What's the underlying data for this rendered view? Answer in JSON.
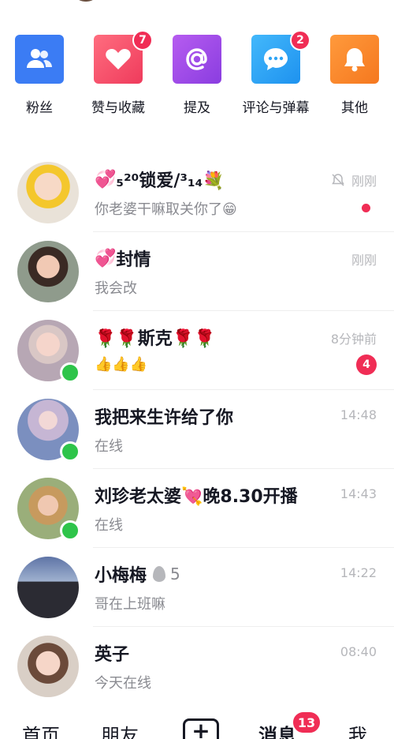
{
  "actions": [
    {
      "label": "粉丝",
      "icon": "fans-icon",
      "color": "#3b7cf4"
    },
    {
      "label": "赞与收藏",
      "icon": "heart-icon",
      "color": "#f24b6a",
      "badge": "7"
    },
    {
      "label": "提及",
      "icon": "at-icon",
      "color": "#9b4ee6"
    },
    {
      "label": "评论与弹幕",
      "icon": "comment-icon",
      "color": "#2ea4f5",
      "badge": "2"
    },
    {
      "label": "其他",
      "icon": "bell-icon",
      "color": "#f7892b"
    }
  ],
  "chats": [
    {
      "name_prefix": "💞",
      "name": "₅²⁰锁爱/³₁₄💐",
      "preview": "你老婆干嘛取关你了😁",
      "time": "刚刚",
      "muted": true,
      "dot": true
    },
    {
      "name_prefix": "💞",
      "name": "封情",
      "preview": "我会改",
      "time": "刚刚"
    },
    {
      "name": "🌹🌹斯克🌹🌹",
      "preview": "👍👍👍",
      "time": "8分钟前",
      "unread": "4",
      "online": true
    },
    {
      "name": "我把来生许给了你",
      "preview": "在线",
      "time": "14:48",
      "online": true
    },
    {
      "name": "刘珍老太婆💘晚8.30开播",
      "preview": "在线",
      "time": "14:43",
      "online": true
    },
    {
      "name": "小梅梅",
      "flame": "5",
      "preview": "哥在上班嘛",
      "time": "14:22"
    },
    {
      "name": "英子",
      "preview": "今天在线",
      "time": "08:40"
    }
  ],
  "tabbar": {
    "home": "首页",
    "friends": "朋友",
    "plus": "+",
    "messages": "消息",
    "messages_badge": "13",
    "me": "我"
  },
  "colors": {
    "accent": "#f02d55",
    "online": "#2ec44a"
  }
}
